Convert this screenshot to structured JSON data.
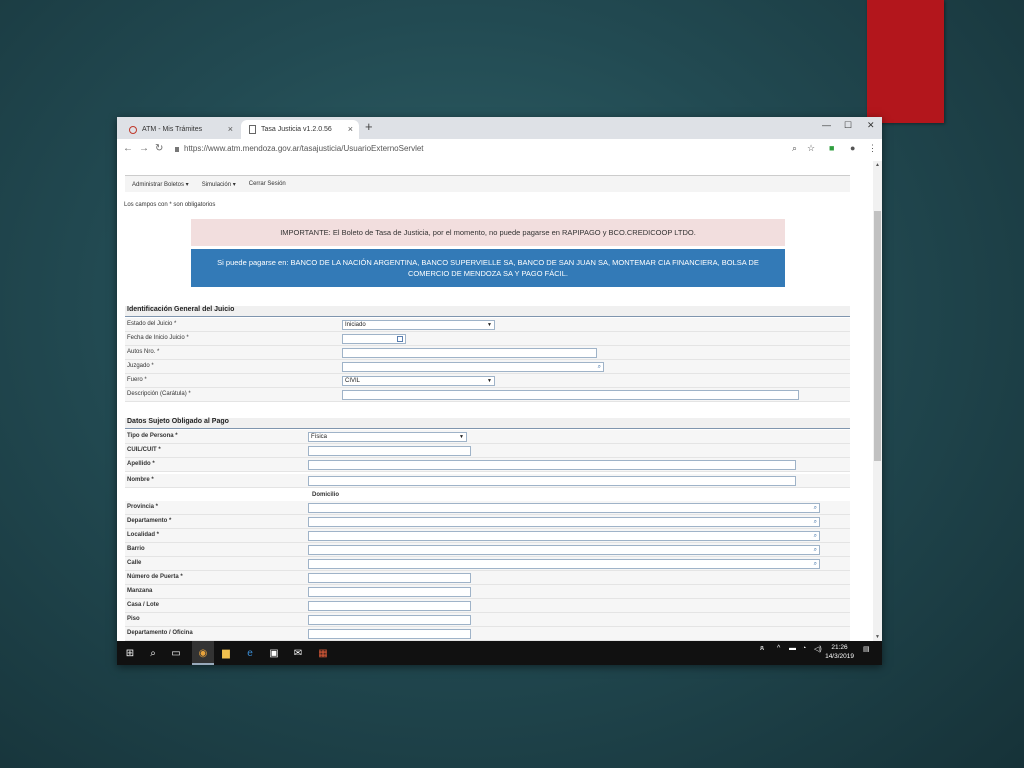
{
  "browser": {
    "tabs": [
      {
        "title": "ATM - Mis Trámites"
      },
      {
        "title": "Tasa Justicia v1.2.0.56"
      }
    ],
    "url": "https://www.atm.mendoza.gov.ar/tasajusticia/UsuarioExternoServlet"
  },
  "menu": {
    "items": [
      "Administrar Boletos ▾",
      "Simulación ▾",
      "Cerrar Sesión"
    ]
  },
  "required_note": "Los campos con * son obligatorios",
  "alerts": {
    "important": "IMPORTANTE: El Boleto de Tasa de Justicia, por el momento, no puede pagarse en RAPIPAGO y BCO.CREDICOOP LTDO.",
    "info": "Si puede pagarse en: BANCO DE LA NACIÓN ARGENTINA, BANCO SUPERVIELLE SA, BANCO DE SAN JUAN SA, MONTEMAR CIA FINANCIERA, BOLSA DE COMERCIO DE MENDOZA SA Y PAGO FÁCIL."
  },
  "juicio": {
    "title": "Identificación General del Juicio",
    "fields": [
      {
        "label": "Estado del Juicio *",
        "value": "Iniciado"
      },
      {
        "label": "Fecha de Inicio Juicio *",
        "value": ""
      },
      {
        "label": "Autos Nro. *",
        "value": ""
      },
      {
        "label": "Juzgado *",
        "value": ""
      },
      {
        "label": "Fuero *",
        "value": "CIVIL"
      },
      {
        "label": "Descripción (Carátula) *",
        "value": ""
      }
    ]
  },
  "sujeto": {
    "title": "Datos Sujeto Obligado al Pago",
    "tipo_persona": {
      "label": "Tipo de Persona *",
      "value": "Física"
    },
    "fields": [
      {
        "label": "CUIL/CUIT *"
      },
      {
        "label": "Apellido *"
      },
      {
        "label": "Nombre *"
      }
    ],
    "domicilio_label": "Domicilio",
    "domicilio": [
      {
        "label": "Provincia *"
      },
      {
        "label": "Departamento *"
      },
      {
        "label": "Localidad *"
      },
      {
        "label": "Barrio"
      },
      {
        "label": "Calle"
      },
      {
        "label": "Número de Puerta *"
      },
      {
        "label": "Manzana"
      },
      {
        "label": "Casa / Lote"
      },
      {
        "label": "Piso"
      },
      {
        "label": "Departamento / Oficina"
      }
    ]
  },
  "taskbar": {
    "time": "21:26",
    "date": "14/3/2019"
  },
  "colors": {
    "accent_red": "#b3161c",
    "info_blue": "#337ab7",
    "warning_pink": "#f2dede"
  }
}
